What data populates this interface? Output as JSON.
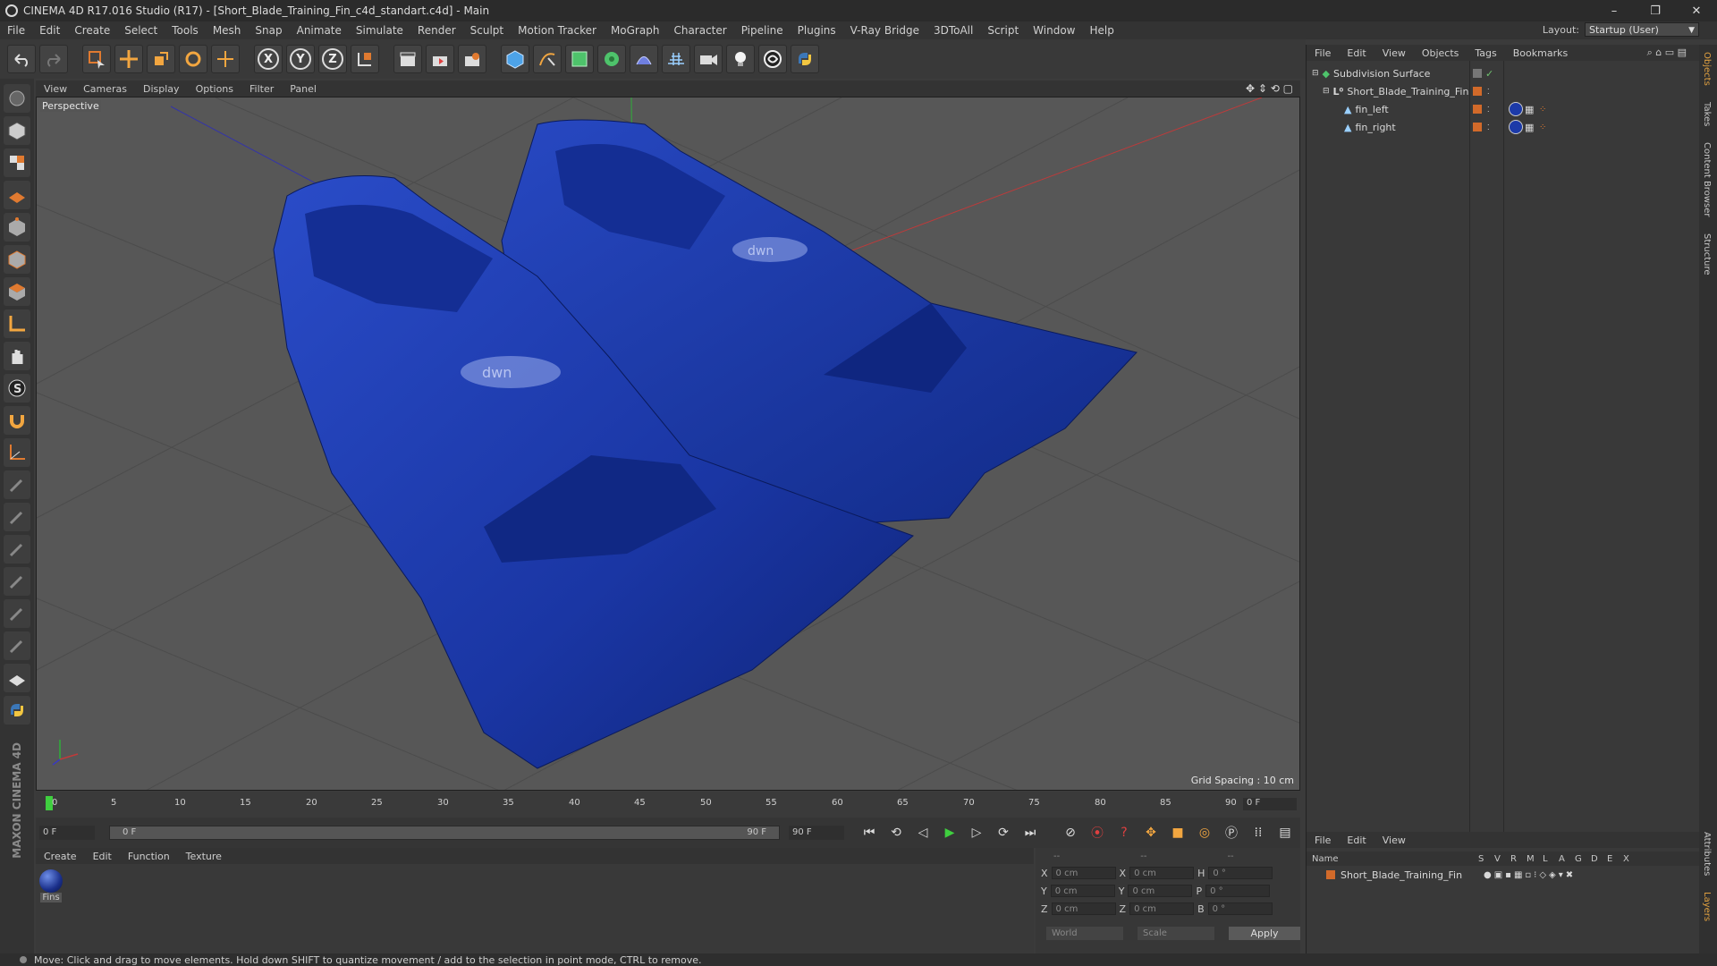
{
  "window": {
    "title": "CINEMA 4D R17.016 Studio (R17) - [Short_Blade_Training_Fin_c4d_standart.c4d] - Main",
    "controls": [
      "–",
      "❐",
      "✕"
    ]
  },
  "menubar": {
    "items": [
      "File",
      "Edit",
      "Create",
      "Select",
      "Tools",
      "Mesh",
      "Snap",
      "Animate",
      "Simulate",
      "Render",
      "Sculpt",
      "Motion Tracker",
      "MoGraph",
      "Character",
      "Pipeline",
      "Plugins",
      "V-Ray Bridge",
      "3DToAll",
      "Script",
      "Window",
      "Help"
    ],
    "layout_label": "Layout:",
    "layout_value": "Startup (User)"
  },
  "toolbar": {
    "axis_x": "X",
    "axis_y": "Y",
    "axis_z": "Z"
  },
  "viewport": {
    "menu": [
      "View",
      "Cameras",
      "Display",
      "Options",
      "Filter",
      "Panel"
    ],
    "label": "Perspective",
    "grid_spacing": "Grid Spacing : 10 cm",
    "logo_text": "dwn"
  },
  "timeline": {
    "ticks": [
      "0",
      "5",
      "10",
      "15",
      "20",
      "25",
      "30",
      "35",
      "40",
      "45",
      "50",
      "55",
      "60",
      "65",
      "70",
      "75",
      "80",
      "85",
      "90"
    ],
    "end_field": "0 F"
  },
  "transport": {
    "start_frame": "0 F",
    "range_start": "0 F",
    "range_end": "90 F",
    "end_frame": "90 F"
  },
  "material_manager": {
    "menu": [
      "Create",
      "Edit",
      "Function",
      "Texture"
    ],
    "material_name": "Fins"
  },
  "coordinates": {
    "header": [
      "--",
      "--",
      "--"
    ],
    "rows": [
      {
        "a_label": "X",
        "a_val": "0 cm",
        "b_label": "X",
        "b_val": "0 cm",
        "c_label": "H",
        "c_val": "0 °"
      },
      {
        "a_label": "Y",
        "a_val": "0 cm",
        "b_label": "Y",
        "b_val": "0 cm",
        "c_label": "P",
        "c_val": "0 °"
      },
      {
        "a_label": "Z",
        "a_val": "0 cm",
        "b_label": "Z",
        "b_val": "0 cm",
        "c_label": "B",
        "c_val": "0 °"
      }
    ],
    "mode": "World",
    "transform": "Scale",
    "apply": "Apply"
  },
  "object_manager": {
    "menu": [
      "File",
      "Edit",
      "View",
      "Objects",
      "Tags",
      "Bookmarks"
    ],
    "objects": [
      {
        "name": "Subdivision Surface",
        "indent": 0
      },
      {
        "name": "Short_Blade_Training_Fin",
        "indent": 1
      },
      {
        "name": "fin_left",
        "indent": 2
      },
      {
        "name": "fin_right",
        "indent": 2
      }
    ]
  },
  "attribute_manager": {
    "menu": [
      "File",
      "Edit",
      "View"
    ],
    "columns": [
      "Name",
      "S",
      "V",
      "R",
      "M",
      "L",
      "A",
      "G",
      "D",
      "E",
      "X"
    ],
    "layer_name": "Short_Blade_Training_Fin"
  },
  "side_tabs": [
    "Objects",
    "Takes",
    "Content Browser",
    "Structure"
  ],
  "side_tabs_bottom": [
    "Attributes",
    "Layers"
  ],
  "status": "Move: Click and drag to move elements. Hold down SHIFT to quantize movement / add to the selection in point mode, CTRL to remove.",
  "brand": "MAXON CINEMA 4D",
  "colors": {
    "accent": "#d26a2a",
    "fin_blue": "#1c3aa8",
    "play_green": "#3fcf3f"
  }
}
